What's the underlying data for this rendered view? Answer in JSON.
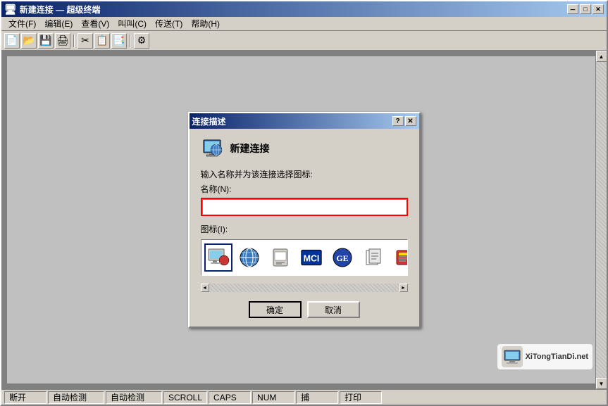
{
  "window": {
    "title": "新建连接 — 超级终端",
    "title_icon": "🖥"
  },
  "title_buttons": {
    "minimize": "－",
    "maximize": "□",
    "close": "✕"
  },
  "menu": {
    "items": [
      {
        "label": "文件(F)"
      },
      {
        "label": "编辑(E)"
      },
      {
        "label": "查看(V)"
      },
      {
        "label": "叫叫(C)"
      },
      {
        "label": "传送(T)"
      },
      {
        "label": "帮助(H)"
      }
    ]
  },
  "toolbar": {
    "buttons": [
      "📄",
      "📂",
      "💾",
      "🖨",
      "✂",
      "📋",
      "📑",
      "⚙"
    ]
  },
  "dialog": {
    "title": "连接描述",
    "help_btn": "?",
    "close_btn": "✕",
    "header_icon": "🖥",
    "header_text": "新建连接",
    "prompt": "输入名称并为该连接选择图标:",
    "name_label": "名称(N):",
    "name_value": "",
    "icon_label": "图标(I):",
    "icons": [
      "🖥",
      "🌐",
      "📋",
      "MCI",
      "⚙",
      "📦",
      "🔧"
    ],
    "ok_label": "确定",
    "cancel_label": "取消"
  },
  "statusbar": {
    "items": [
      {
        "label": "断开"
      },
      {
        "label": "自动检测"
      },
      {
        "label": "自动检测"
      },
      {
        "label": "SCROLL"
      },
      {
        "label": "CAPS"
      },
      {
        "label": "NUM"
      },
      {
        "label": "捕"
      },
      {
        "label": "打印"
      }
    ]
  },
  "watermark": {
    "site": "XiTongTianDi.net"
  }
}
